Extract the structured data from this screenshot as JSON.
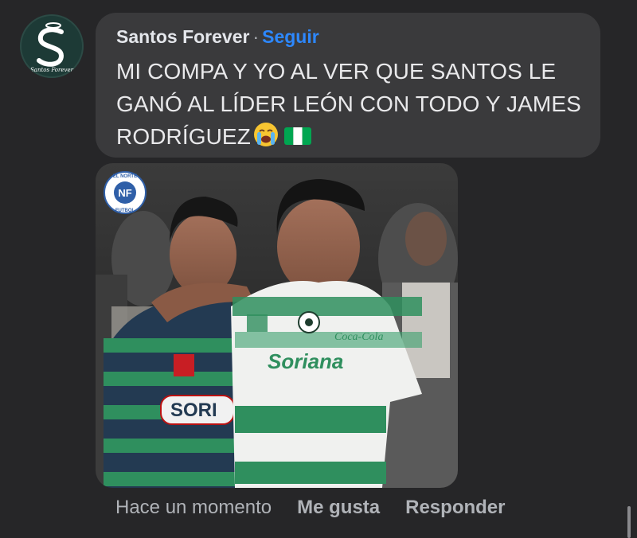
{
  "post": {
    "author": "Santos Forever",
    "separator": "·",
    "follow_label": "Seguir",
    "text": "MI COMPA Y YO AL VER QUE SANTOS LE GANÓ AL LÍDER LEÓN CON TODO Y JAMES RODRÍGUEZ",
    "emojis": [
      "loudly-crying-face",
      "nigeria-flag"
    ],
    "avatar": {
      "brand_text": "Santos Forever",
      "bg_color": "#1d3a36"
    }
  },
  "photo": {
    "watermark": {
      "top_text": "EL NORTE",
      "bottom_text": "FUTBOL",
      "monogram": "NF"
    },
    "jersey_sponsor": "Soriana",
    "jersey_sponsor_cropped": "SORI",
    "jersey_brand": "Coca-Cola",
    "colors": {
      "green": "#2f8f5e",
      "white": "#f0f1ef",
      "dark_stripe": "#233a52"
    }
  },
  "actions": {
    "timestamp": "Hace un momento",
    "like_label": "Me gusta",
    "reply_label": "Responder"
  },
  "colors": {
    "background": "#262628",
    "bubble": "#3a3a3c",
    "link": "#2d88ff",
    "muted": "#b0b3b8"
  }
}
